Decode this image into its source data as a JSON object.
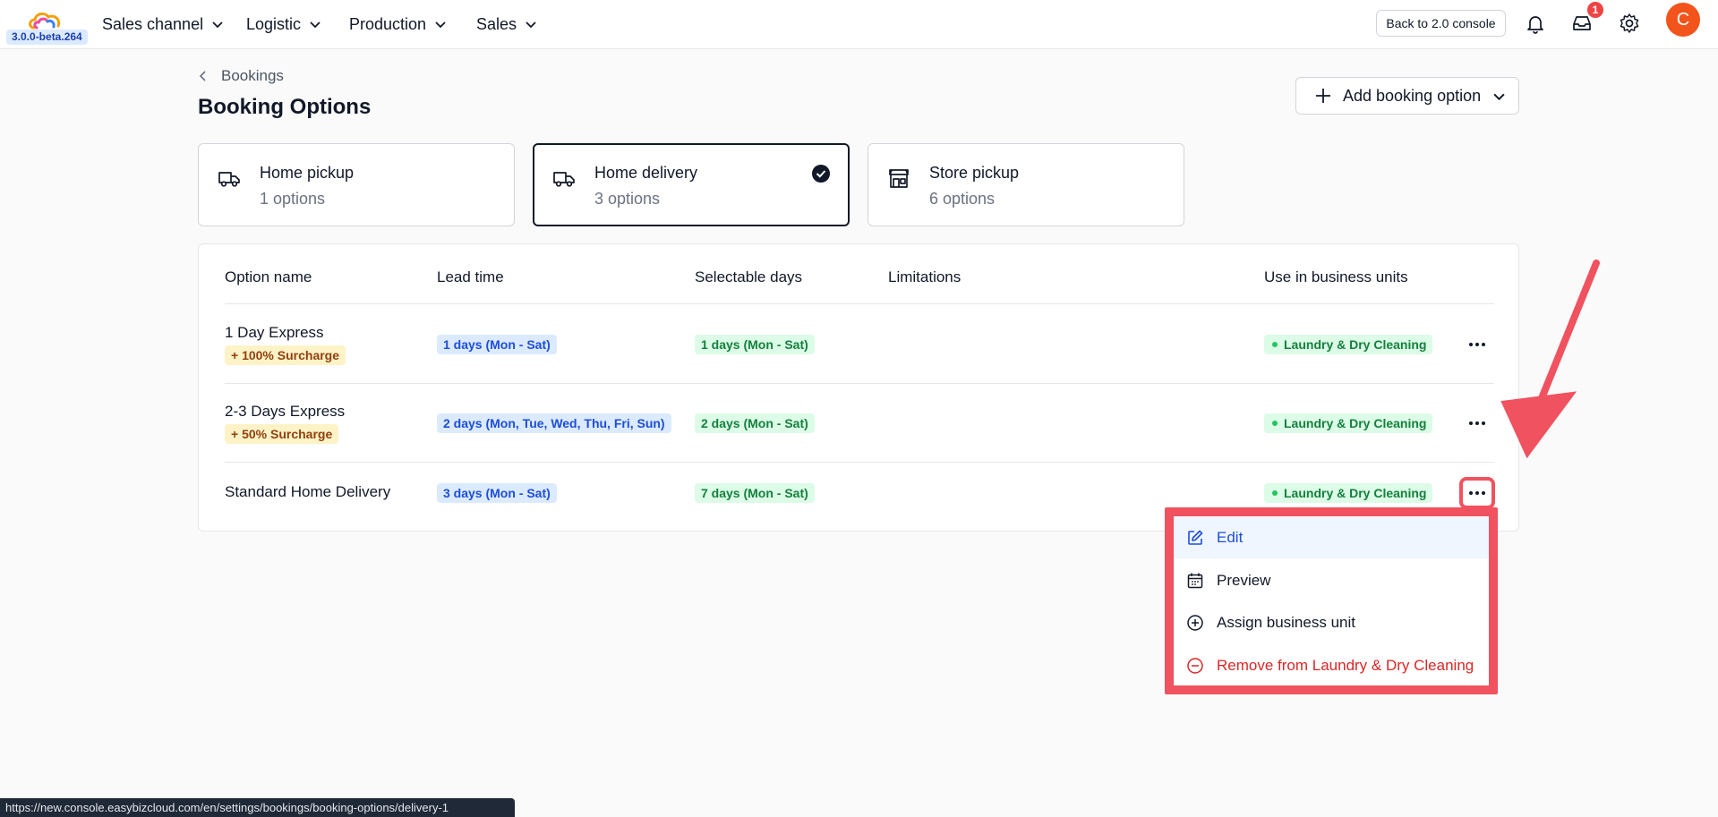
{
  "app": {
    "version": "3.0.0-beta.264"
  },
  "nav": {
    "items": [
      {
        "label": "Sales channel"
      },
      {
        "label": "Logistic"
      },
      {
        "label": "Production"
      },
      {
        "label": "Sales"
      }
    ],
    "back_label": "Back to 2.0 console",
    "notifications_count": "1",
    "avatar_initial": "C"
  },
  "header": {
    "breadcrumb": "Bookings",
    "title": "Booking Options",
    "add_button_label": "Add booking option"
  },
  "tabs": [
    {
      "name": "Home pickup",
      "count": "1 options",
      "icon": "truck-icon",
      "selected": false
    },
    {
      "name": "Home delivery",
      "count": "3 options",
      "icon": "truck-icon",
      "selected": true
    },
    {
      "name": "Store pickup",
      "count": "6 options",
      "icon": "store-icon",
      "selected": false
    }
  ],
  "table": {
    "columns": [
      "Option name",
      "Lead time",
      "Selectable days",
      "Limitations",
      "Use in business units"
    ],
    "rows": [
      {
        "name": "1 Day Express",
        "surcharge": "+ 100% Surcharge",
        "lead_time": "1 days  (Mon - Sat)",
        "selectable_days": "1 days (Mon - Sat)",
        "limitations": "",
        "business_unit": "Laundry & Dry Cleaning"
      },
      {
        "name": "2-3 Days Express",
        "surcharge": "+ 50% Surcharge",
        "lead_time": "2 days  (Mon, Tue, Wed, Thu, Fri, Sun)",
        "selectable_days": "2 days (Mon - Sat)",
        "limitations": "",
        "business_unit": "Laundry & Dry Cleaning"
      },
      {
        "name": "Standard Home Delivery",
        "surcharge": "",
        "lead_time": "3 days  (Mon - Sat)",
        "selectable_days": "7 days (Mon - Sat)",
        "limitations": "",
        "business_unit": "Laundry & Dry Cleaning"
      }
    ]
  },
  "context_menu": {
    "items": [
      {
        "label": "Edit",
        "icon": "edit-icon"
      },
      {
        "label": "Preview",
        "icon": "calendar-icon"
      },
      {
        "label": "Assign business unit",
        "icon": "plus-circle-icon"
      },
      {
        "label": "Remove from Laundry & Dry Cleaning",
        "icon": "minus-circle-icon"
      }
    ]
  },
  "status_url": "https://new.console.easybizcloud.com/en/settings/bookings/booking-options/delivery-1",
  "colors": {
    "accent": "#1d4ed8",
    "annotation": "#f0525f",
    "avatar": "#f2541b",
    "danger": "#dc2626"
  }
}
